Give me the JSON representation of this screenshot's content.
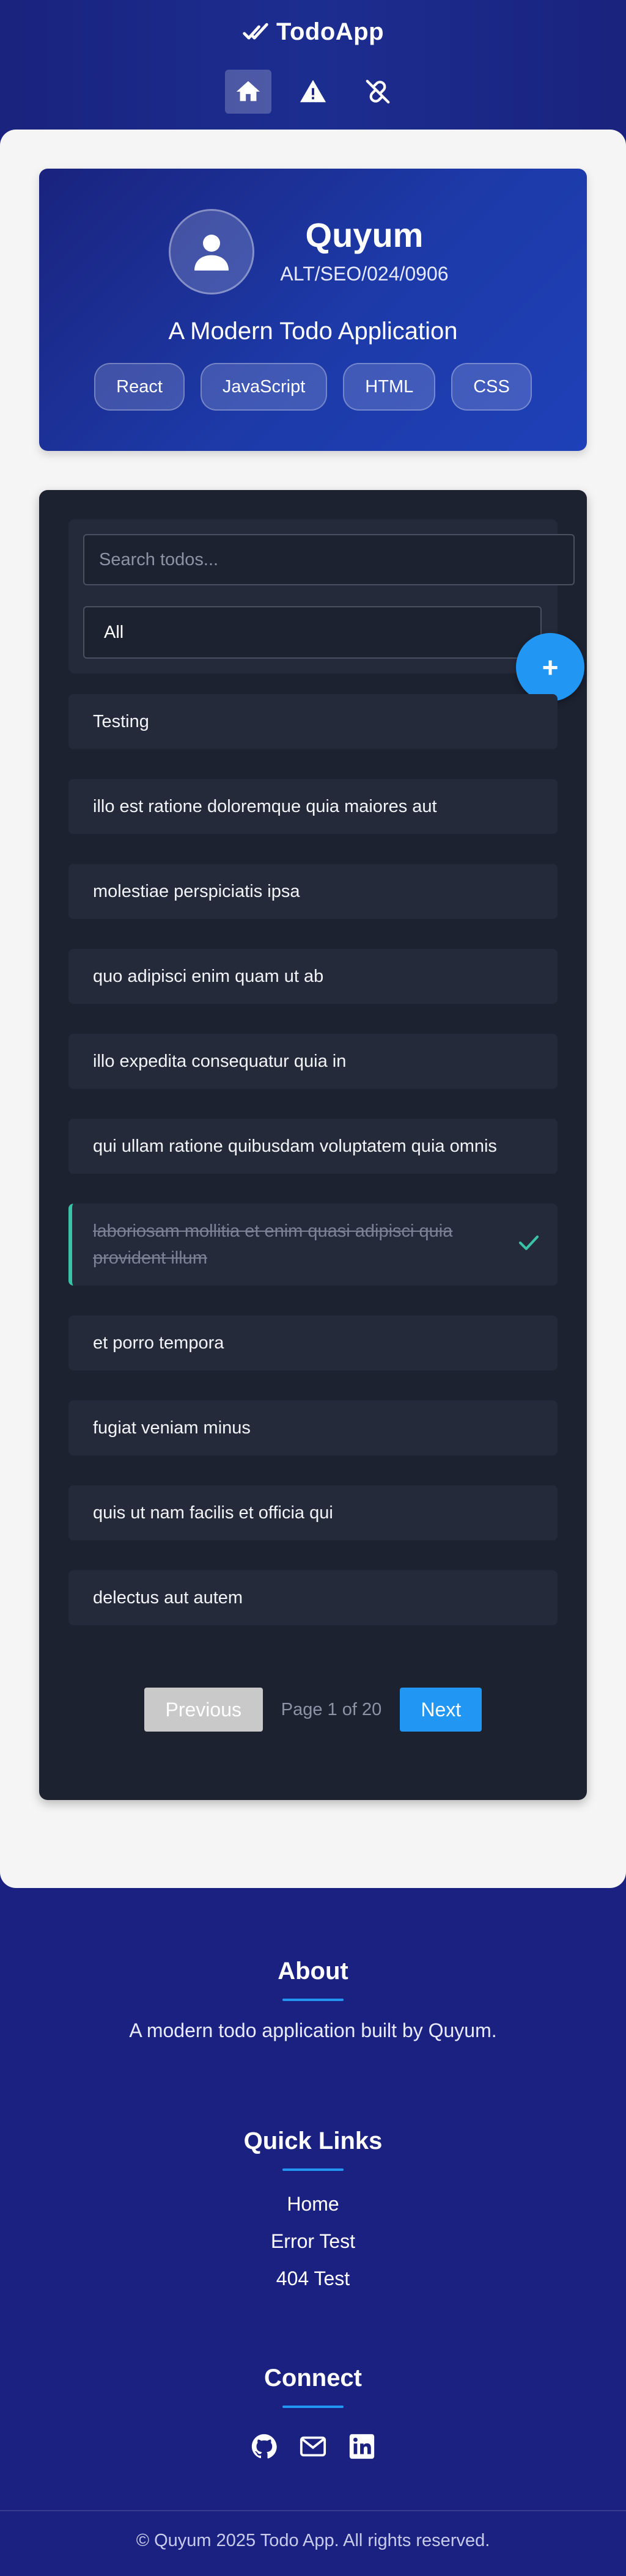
{
  "header": {
    "brand": "TodoApp",
    "nav": [
      {
        "icon": "home-icon",
        "active": true
      },
      {
        "icon": "warning-icon",
        "active": false
      },
      {
        "icon": "broken-link-icon",
        "active": false
      }
    ]
  },
  "profile": {
    "name": "Quyum",
    "id": "ALT/SEO/024/0906",
    "tagline": "A Modern Todo Application",
    "tags": [
      "React",
      "JavaScript",
      "HTML",
      "CSS"
    ]
  },
  "todos": {
    "search_placeholder": "Search todos...",
    "filter_value": "All",
    "add_label": "+",
    "items": [
      {
        "title": "Testing",
        "completed": false
      },
      {
        "title": "illo est ratione doloremque quia maiores aut",
        "completed": false
      },
      {
        "title": "molestiae perspiciatis ipsa",
        "completed": false
      },
      {
        "title": "quo adipisci enim quam ut ab",
        "completed": false
      },
      {
        "title": "illo expedita consequatur quia in",
        "completed": false
      },
      {
        "title": "qui ullam ratione quibusdam voluptatem quia omnis",
        "completed": false
      },
      {
        "title": "laboriosam mollitia et enim quasi adipisci quia provident illum",
        "completed": true
      },
      {
        "title": "et porro tempora",
        "completed": false
      },
      {
        "title": "fugiat veniam minus",
        "completed": false
      },
      {
        "title": "quis ut nam facilis et officia qui",
        "completed": false
      },
      {
        "title": "delectus aut autem",
        "completed": false
      }
    ],
    "pager": {
      "prev": "Previous",
      "info": "Page 1 of 20",
      "next": "Next"
    }
  },
  "footer": {
    "about_title": "About",
    "about_text": "A modern todo application built by Quyum.",
    "links_title": "Quick Links",
    "links": [
      "Home",
      "Error Test",
      "404 Test"
    ],
    "connect_title": "Connect",
    "social": [
      "github-icon",
      "mail-icon",
      "linkedin-icon"
    ],
    "copyright": "© Quyum 2025 Todo App. All rights reserved."
  },
  "colors": {
    "accent": "#2196f3",
    "header": "#1a237e",
    "panel": "#1c2230",
    "done_border": "#3bc3a7"
  }
}
